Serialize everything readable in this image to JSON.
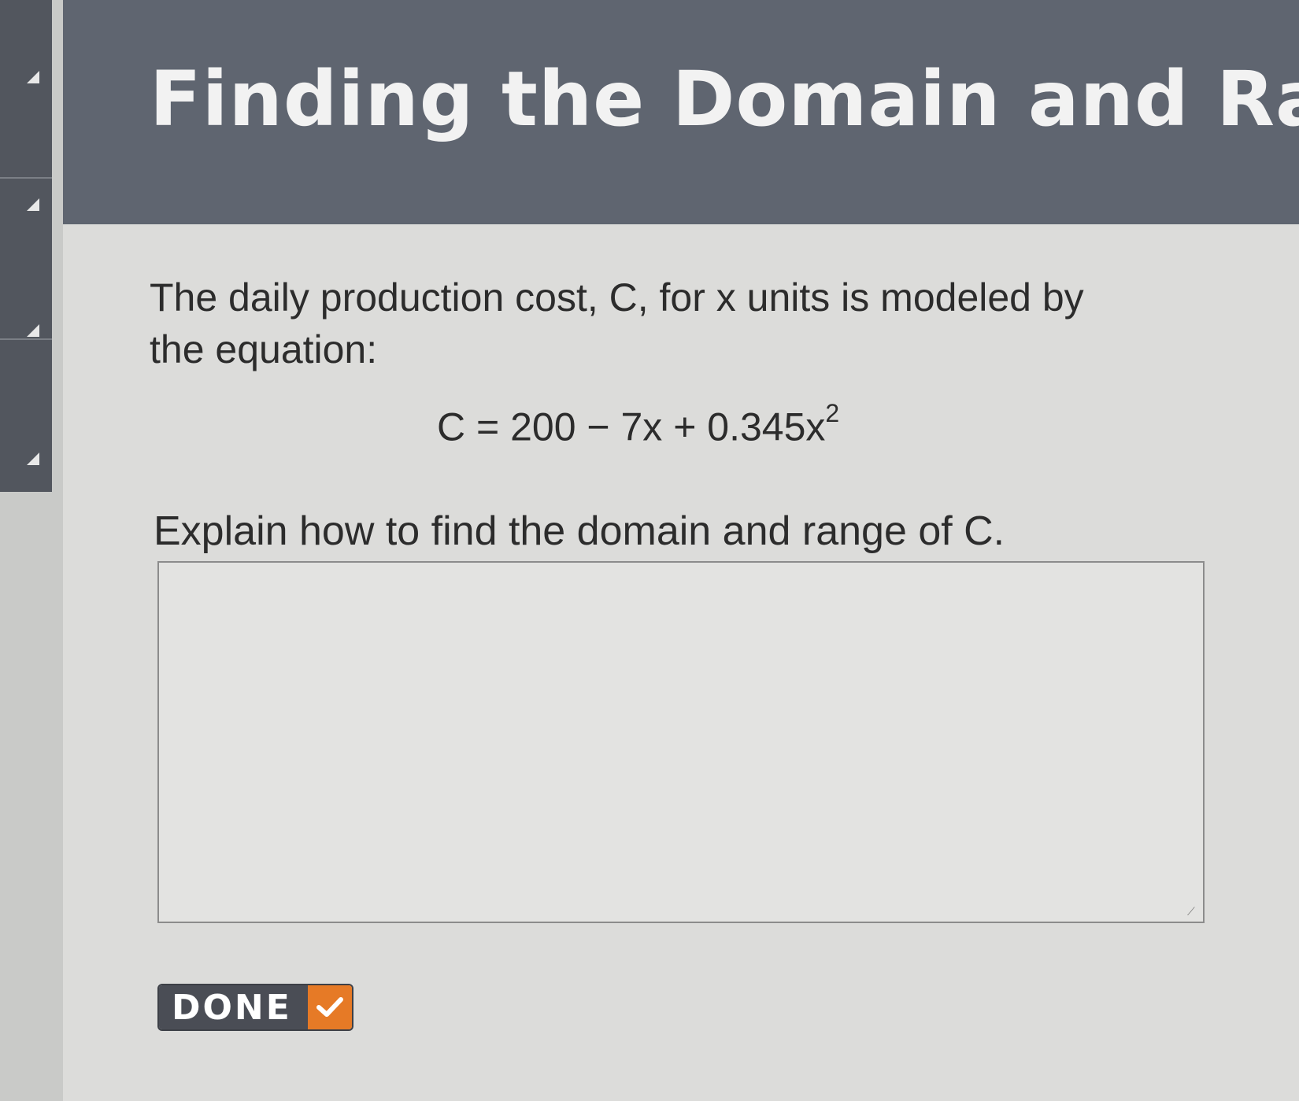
{
  "header": {
    "title": "Finding the Domain and Rang"
  },
  "question": {
    "text": "The daily production cost, C, for x units is modeled by the equation:",
    "equation_main": "C = 200 − 7x + 0.345x",
    "equation_exponent": "2",
    "prompt": "Explain how to find the domain and range of C."
  },
  "answer": {
    "value": "",
    "placeholder": ""
  },
  "done_button": {
    "label": "DONE",
    "icon": "checkmark-icon"
  },
  "colors": {
    "header_bg": "#5f6570",
    "content_bg": "#dcdcda",
    "done_bg": "#4a4d55",
    "done_accent": "#e67a26"
  }
}
